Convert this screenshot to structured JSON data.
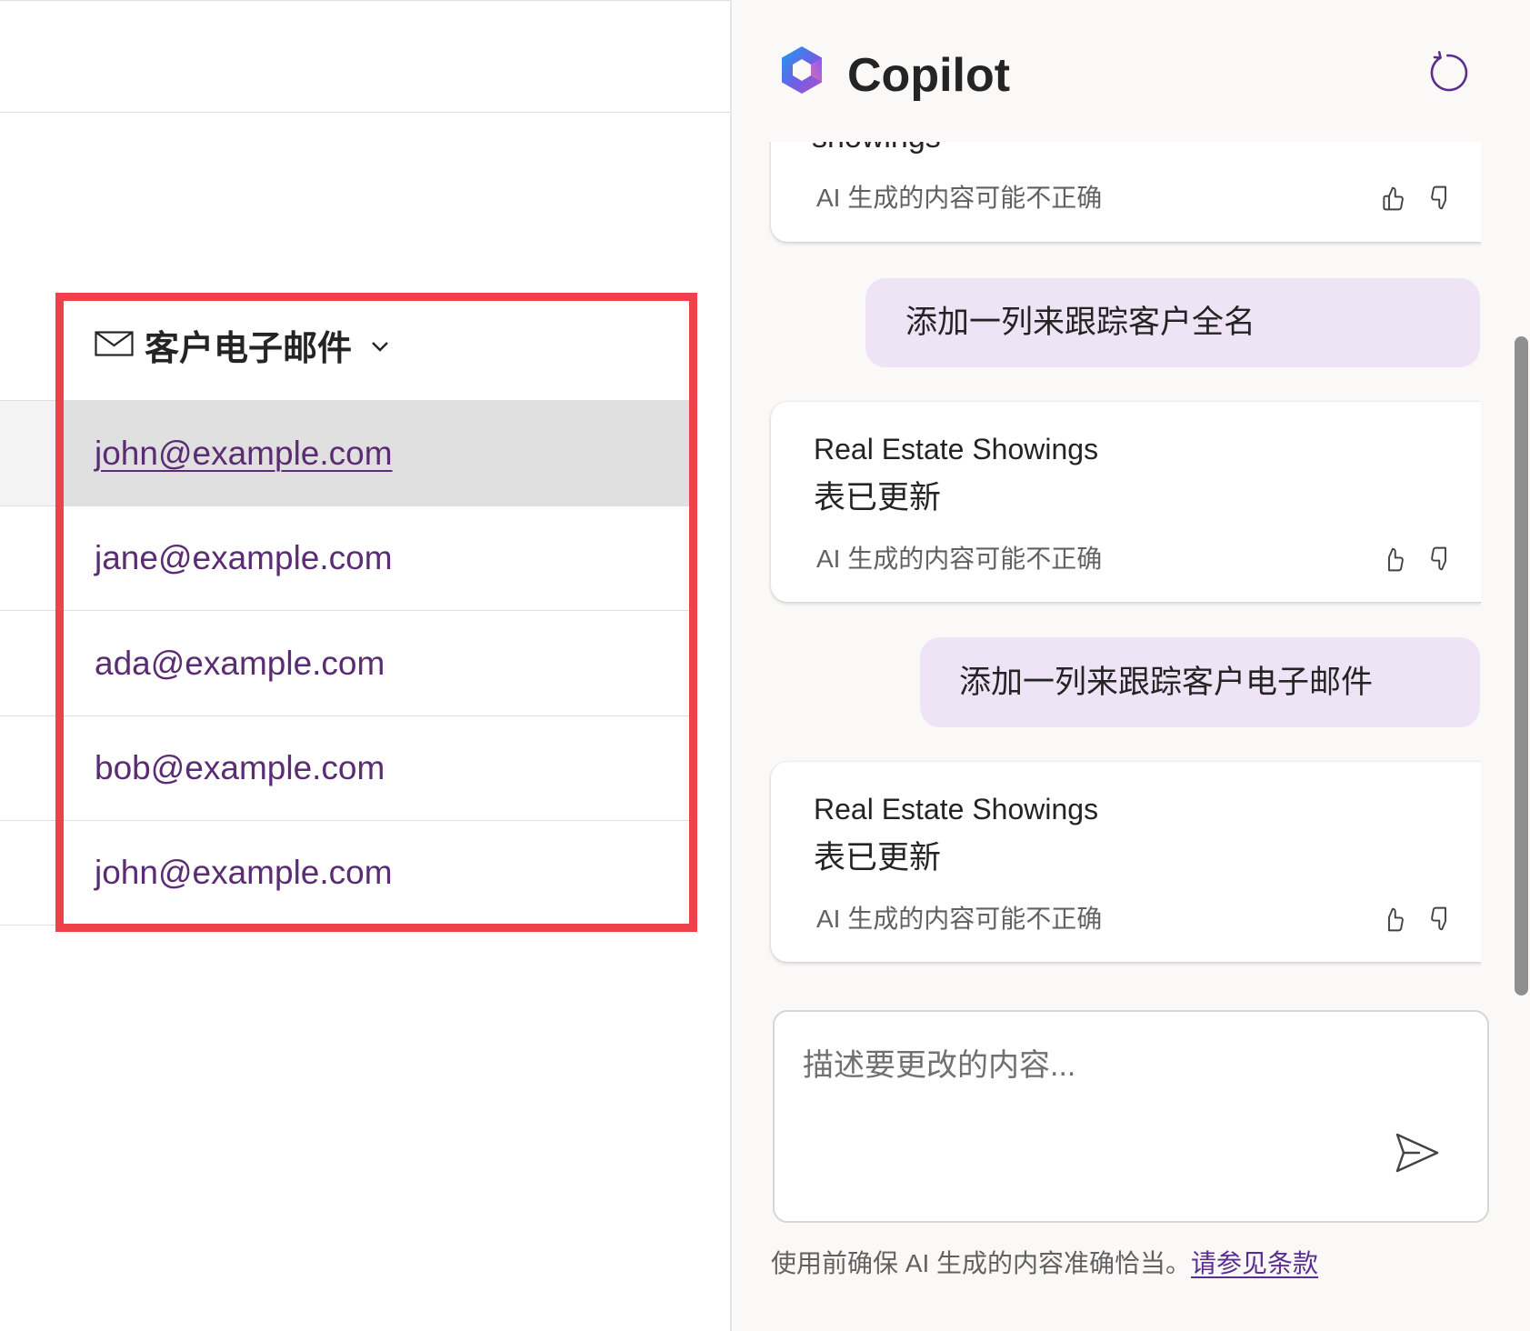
{
  "colors": {
    "accent": "#5c2d91",
    "email_text": "#5b2c74",
    "highlight_border": "#ef4149",
    "user_bubble": "#efe4f5",
    "selected_row": "#e1e0e0"
  },
  "table": {
    "column_header": {
      "icon": "mail-icon",
      "label": "客户电子邮件",
      "menu_icon": "chevron-down-icon"
    },
    "rows": [
      "john@example.com",
      "jane@example.com",
      "ada@example.com",
      "bob@example.com",
      "john@example.com"
    ],
    "selected_row": 0
  },
  "copilot": {
    "logo_icon": "copilot-logo-icon",
    "title": "Copilot",
    "refresh_icon": "refresh-icon",
    "messages": [
      {
        "role": "assistant",
        "text": "showings",
        "disclaimer": "AI 生成的内容可能不正确"
      },
      {
        "role": "user",
        "text": "添加一列来跟踪客户全名"
      },
      {
        "role": "assistant",
        "title": "Real Estate Showings",
        "text": "表已更新",
        "disclaimer": "AI 生成的内容可能不正确"
      },
      {
        "role": "user",
        "text": "添加一列来跟踪客户电子邮件"
      },
      {
        "role": "assistant",
        "title": "Real Estate Showings",
        "text": "表已更新",
        "disclaimer": "AI 生成的内容可能不正确"
      }
    ],
    "feedback_icons": [
      "thumbs-up-icon",
      "thumbs-down-icon"
    ],
    "composer": {
      "placeholder": "描述要更改的内容...",
      "send_icon": "send-icon"
    },
    "footer": {
      "note": "使用前确保 AI 生成的内容准确恰当。",
      "terms_link": "请参见条款"
    }
  }
}
